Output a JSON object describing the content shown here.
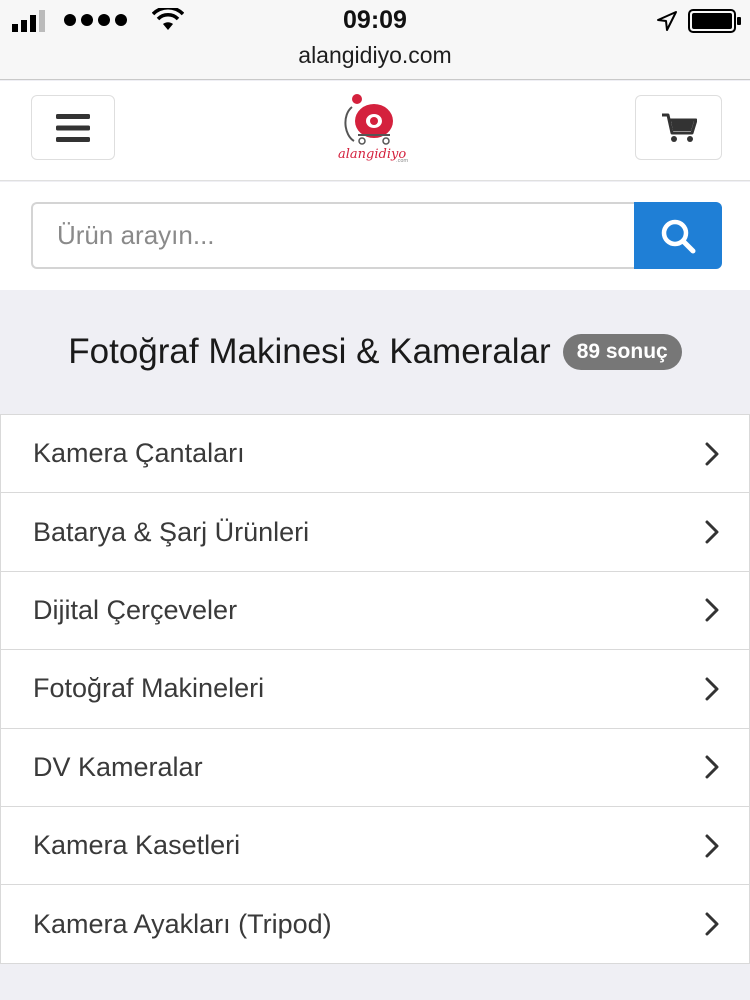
{
  "status_bar": {
    "time": "09:09",
    "url": "alangidiyo.com"
  },
  "header": {
    "logo_text": "alangidiyo",
    "logo_subtext": ".com",
    "icons": [
      "hamburger-menu-icon",
      "shopping-cart-icon",
      "search-icon"
    ]
  },
  "search": {
    "placeholder": "Ürün arayın..."
  },
  "category": {
    "title": "Fotoğraf Makinesi & Kameralar",
    "count_badge": "89 sonuç"
  },
  "subcategories": [
    {
      "label": "Kamera Çantaları"
    },
    {
      "label": "Batarya & Şarj Ürünleri"
    },
    {
      "label": "Dijital Çerçeveler"
    },
    {
      "label": "Fotoğraf Makineleri"
    },
    {
      "label": "DV Kameralar"
    },
    {
      "label": "Kamera Kasetleri"
    },
    {
      "label": "Kamera Ayakları (Tripod)"
    }
  ],
  "colors": {
    "accent_blue": "#1f7fd6",
    "logo_red": "#d4213d",
    "badge_gray": "#777777",
    "page_bg": "#efeff4"
  }
}
